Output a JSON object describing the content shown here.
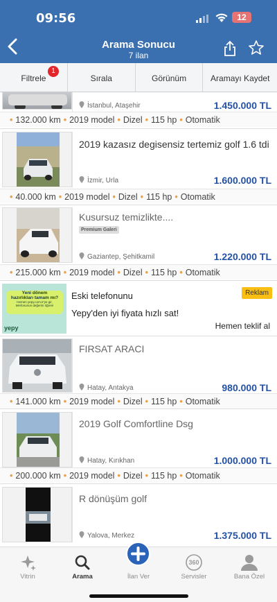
{
  "status": {
    "time": "09:56",
    "battery": "12"
  },
  "header": {
    "title": "Arama Sonucu",
    "subtitle": "7 ilan"
  },
  "filterbar": {
    "filter_label": "Filtrele",
    "filter_count": "1",
    "sort_label": "Sırala",
    "view_label": "Görünüm",
    "save_label": "Aramayı Kaydet"
  },
  "listings": [
    {
      "title": "",
      "location": "İstanbul, Ataşehir",
      "price": "1.450.000 TL",
      "km": "132.000 km",
      "model": "2019 model",
      "fuel": "Dizel",
      "hp": "115 hp",
      "gear": "Otomatik"
    },
    {
      "title": "2019 kazasız degisensiz tertemiz golf 1.6 tdi",
      "location": "İzmir, Urla",
      "price": "1.600.000 TL",
      "km": "40.000 km",
      "model": "2019 model",
      "fuel": "Dizel",
      "hp": "115 hp",
      "gear": "Otomatik"
    },
    {
      "title": "Kusursuz temizlikte....",
      "badge": "Premium Galeri",
      "location": "Gaziantep, Şehitkamil",
      "price": "1.220.000 TL",
      "km": "215.000 km",
      "model": "2019 model",
      "fuel": "Dizel",
      "hp": "115 hp",
      "gear": "Otomatik"
    },
    {
      "title": "FIRSAT ARACI",
      "location": "Hatay, Antakya",
      "price": "980.000 TL",
      "km": "141.000 km",
      "model": "2019 model",
      "fuel": "Dizel",
      "hp": "115 hp",
      "gear": "Otomatik"
    },
    {
      "title": "2019 Golf Comfortline Dsg",
      "location": "Hatay, Kırıkhan",
      "price": "1.000.000 TL",
      "km": "200.000 km",
      "model": "2019 model",
      "fuel": "Dizel",
      "hp": "115 hp",
      "gear": "Otomatik"
    },
    {
      "title": "R dönüşüm golf",
      "location": "Yalova, Merkez",
      "price": "1.375.000 TL"
    }
  ],
  "ad": {
    "title": "Eski telefonunu",
    "text": "Yepy'den iyi fiyata hızlı sat!",
    "badge": "Reklam",
    "cta": "Hemen teklif al",
    "image_line1": "Yeni dönem",
    "image_line2": "hazırlıkları tamam mı?",
    "image_line3": "Hemen yepy.com.tr'ye gir,",
    "image_line4": "telefonunun değerini öğren!",
    "logo": "yepy"
  },
  "tabbar": {
    "vitrin": "Vitrin",
    "arama": "Arama",
    "ilan_ver": "İlan Ver",
    "servisler": "Servisler",
    "bana_ozel": "Bana Özel",
    "badge_360": "360"
  },
  "colors": {
    "header": "#3a6fb0",
    "price": "#2251a8",
    "accent": "#e8a04a",
    "ad_badge": "#fbbf14"
  }
}
